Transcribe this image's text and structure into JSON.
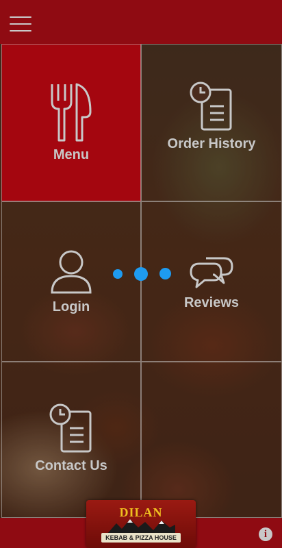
{
  "header": {
    "menu_icon": "hamburger-icon"
  },
  "tiles": [
    {
      "label": "Menu",
      "icon": "fork-knife-icon"
    },
    {
      "label": "Order History",
      "icon": "clock-document-icon"
    },
    {
      "label": "Login",
      "icon": "user-icon"
    },
    {
      "label": "Reviews",
      "icon": "chat-bubbles-icon"
    },
    {
      "label": "Contact Us",
      "icon": "clock-document-icon"
    }
  ],
  "logo": {
    "title": "DILAN",
    "subtitle": "KEBAB & PIZZA HOUSE"
  },
  "footer": {
    "info_icon": "info-icon",
    "info_glyph": "i"
  },
  "colors": {
    "brand_red": "#a4060f",
    "header_red": "#8f0b12",
    "loader_blue": "#1e9bf0"
  }
}
